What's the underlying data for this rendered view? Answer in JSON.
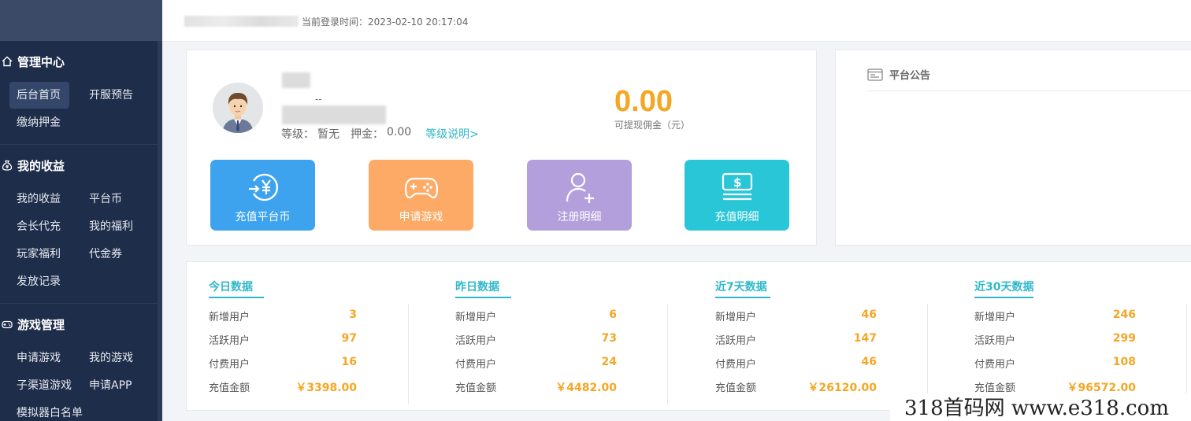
{
  "header": {
    "login_time": "当前登录时间：2023-02-10 20:17:04"
  },
  "sidebar": {
    "groups": [
      {
        "title": "管理中心",
        "icon": "home-icon",
        "items": [
          "后台首页",
          "开服预告",
          "缴纳押金"
        ]
      },
      {
        "title": "我的收益",
        "icon": "money-bag-icon",
        "items": [
          "我的收益",
          "平台币",
          "会长代充",
          "我的福利",
          "玩家福利",
          "代金券",
          "发放记录"
        ]
      },
      {
        "title": "游戏管理",
        "icon": "gamepad-icon",
        "items": [
          "申请游戏",
          "我的游戏",
          "子渠道游戏",
          "申请APP",
          "模拟器白名单"
        ]
      }
    ]
  },
  "profile": {
    "dash": "--",
    "level_label": "等级：",
    "level_value": "暂无",
    "deposit_label": "押金：",
    "deposit_value": "0.00",
    "level_link": "等级说明>",
    "commission_value": "0.00",
    "commission_label": "可提现佣金（元）"
  },
  "quick_actions": [
    {
      "label": "充值平台币",
      "icon": "recharge-yen-icon",
      "color": "#3da3ef"
    },
    {
      "label": "申请游戏",
      "icon": "gamepad-icon",
      "color": "#fdaa66"
    },
    {
      "label": "注册明细",
      "icon": "add-user-icon",
      "color": "#b39fdc"
    },
    {
      "label": "充值明细",
      "icon": "cash-icon",
      "color": "#29c6d8"
    }
  ],
  "notice": {
    "title": "平台公告"
  },
  "stats": [
    {
      "title": "今日数据",
      "rows": [
        {
          "label": "新增用户",
          "value": "3"
        },
        {
          "label": "活跃用户",
          "value": "97"
        },
        {
          "label": "付费用户",
          "value": "16"
        },
        {
          "label": "充值金额",
          "value": "￥3398.00"
        }
      ]
    },
    {
      "title": "昨日数据",
      "rows": [
        {
          "label": "新增用户",
          "value": "6"
        },
        {
          "label": "活跃用户",
          "value": "73"
        },
        {
          "label": "付费用户",
          "value": "24"
        },
        {
          "label": "充值金额",
          "value": "￥4482.00"
        }
      ]
    },
    {
      "title": "近7天数据",
      "rows": [
        {
          "label": "新增用户",
          "value": "46"
        },
        {
          "label": "活跃用户",
          "value": "147"
        },
        {
          "label": "付费用户",
          "value": "46"
        },
        {
          "label": "充值金额",
          "value": "￥26120.00"
        }
      ]
    },
    {
      "title": "近30天数据",
      "rows": [
        {
          "label": "新增用户",
          "value": "246"
        },
        {
          "label": "活跃用户",
          "value": "299"
        },
        {
          "label": "付费用户",
          "value": "108"
        },
        {
          "label": "充值金额",
          "value": "￥96572.00"
        }
      ]
    }
  ],
  "watermark": "318首码网  www.e318.com",
  "colors": {
    "sidebar_bg": "#1e2d4a",
    "accent": "#2fb8c9",
    "value": "#f5a623"
  }
}
